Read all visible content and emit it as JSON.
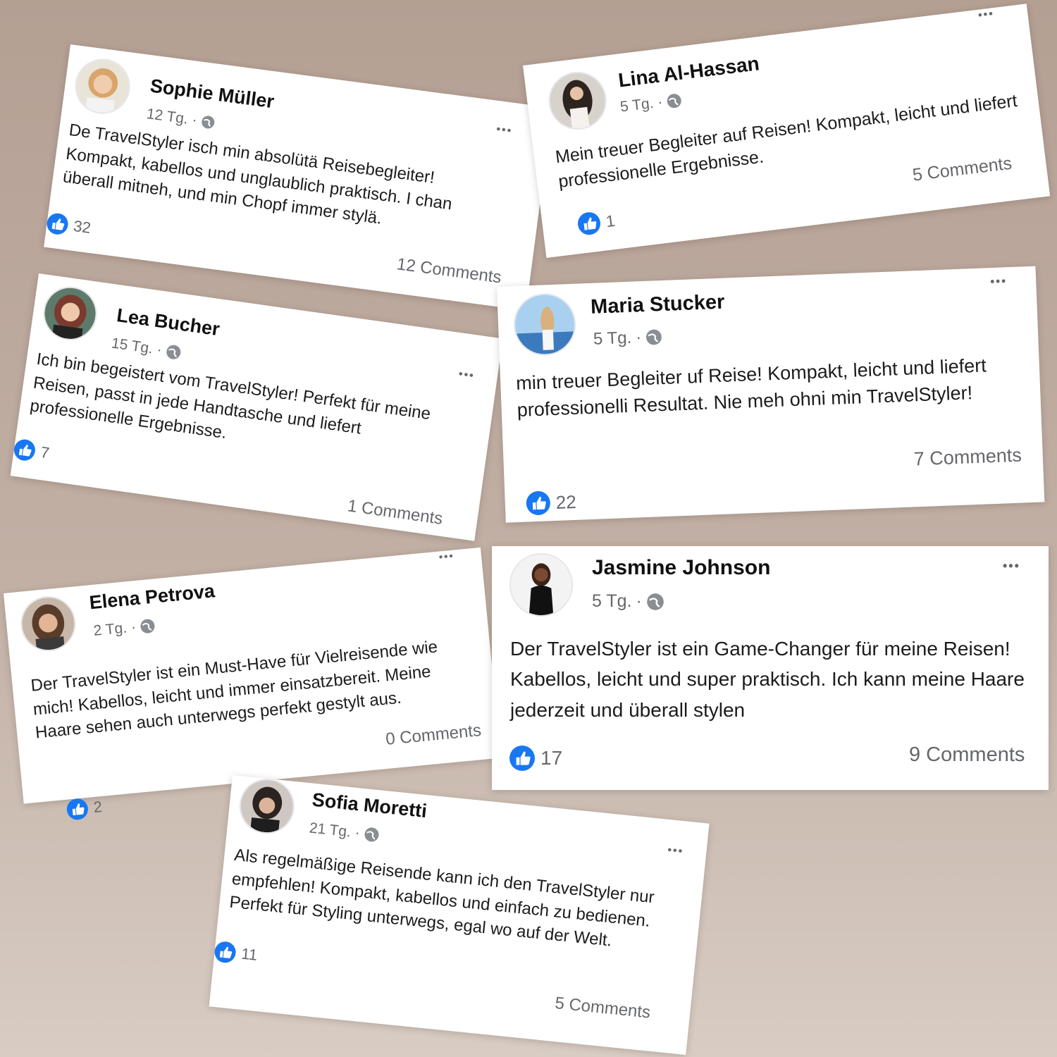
{
  "posts": [
    {
      "name": "Sophie Müller",
      "time": "12 Tg.",
      "text": "De TravelStyler isch min absolütä Reisebegleiter! Kompakt, kabellos und unglaublich praktisch. I chan überall mitneh, und min Chopf immer stylä.",
      "likes": "32",
      "comments": "12 Comments",
      "avatar_color": "#c9a27a"
    },
    {
      "name": "Lina Al-Hassan",
      "time": "5 Tg.",
      "text": "Mein treuer Begleiter auf Reisen! Kompakt, leicht und liefert professionelle Ergebnisse.",
      "likes": "1",
      "comments": "5 Comments",
      "avatar_color": "#3a2e2a"
    },
    {
      "name": "Lea Bucher",
      "time": "15 Tg.",
      "text": "Ich bin begeistert vom TravelStyler! Perfekt für meine Reisen, passt in jede Handtasche und liefert professionelle Ergebnisse.",
      "likes": "7",
      "comments": "1 Comments",
      "avatar_color": "#8b4a3c"
    },
    {
      "name": "Maria Stucker",
      "time": "5 Tg.",
      "text": "min treuer Begleiter uf Reise! Kompakt, leicht und liefert professionelli Resultat. Nie meh ohni min TravelStyler!",
      "likes": "22",
      "comments": "7 Comments",
      "avatar_color": "#6fa8d6"
    },
    {
      "name": "Elena Petrova",
      "time": "2 Tg.",
      "text": "Der TravelStyler ist ein Must-Have für Vielreisende wie mich! Kabellos, leicht und immer einsatzbereit. Meine Haare sehen auch unterwegs perfekt gestylt aus.",
      "likes": "2",
      "comments": "0 Comments",
      "avatar_color": "#7a5a44"
    },
    {
      "name": "Jasmine Johnson",
      "time": "5 Tg.",
      "text": "Der TravelStyler ist ein Game-Changer für meine Reisen! Kabellos, leicht und super praktisch. Ich kann meine Haare jederzeit und überall stylen",
      "likes": "17",
      "comments": "9 Comments",
      "avatar_color": "#4a3328"
    },
    {
      "name": "Sofia Moretti",
      "time": "21 Tg.",
      "text": "Als regelmäßige Reisende kann ich den TravelStyler nur empfehlen! Kompakt, kabellos und einfach zu bedienen. Perfekt für Styling unterwegs, egal wo auf der Welt.",
      "likes": "11",
      "comments": "5 Comments",
      "avatar_color": "#2e2a28"
    }
  ],
  "meta_separator": "·",
  "more_glyph": "•••",
  "colors": {
    "like_blue": "#1877f2",
    "meta_gray": "#65676b"
  },
  "icons": {
    "like": "thumbs-up-icon",
    "audience": "globe-icon",
    "more": "more-options-icon"
  }
}
